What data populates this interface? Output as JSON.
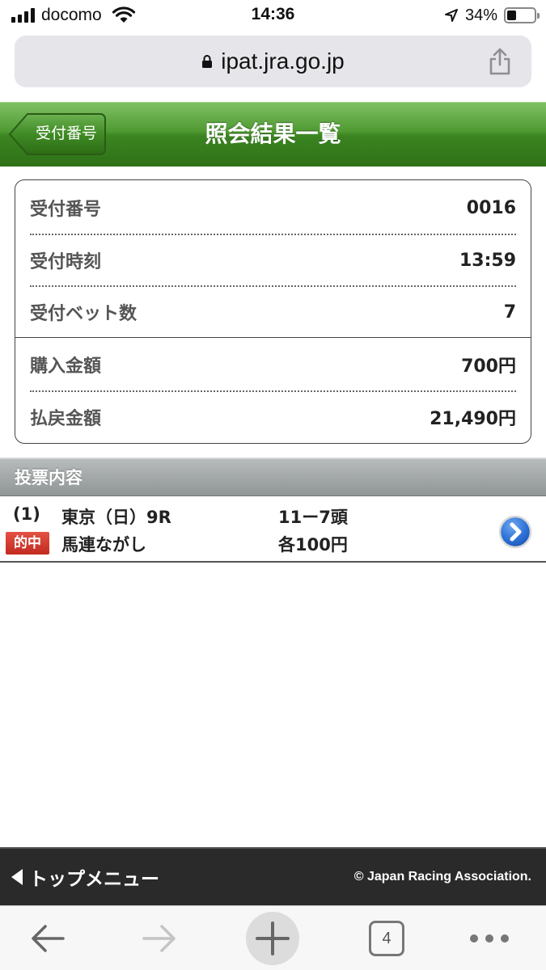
{
  "status_bar": {
    "carrier": "docomo",
    "time": "14:36",
    "battery_percent": "34%",
    "battery_level": 0.34
  },
  "browser": {
    "url": "ipat.jra.go.jp",
    "open_tabs": "4"
  },
  "header": {
    "back_label": "受付番号",
    "title": "照会結果一覧"
  },
  "summary": {
    "receipt_number": {
      "label": "受付番号",
      "value": "0016"
    },
    "receipt_time": {
      "label": "受付時刻",
      "value": "13:59"
    },
    "bet_count": {
      "label": "受付ベット数",
      "value": "7"
    },
    "purchase_amount": {
      "label": "購入金額",
      "value": "700円"
    },
    "payout_amount": {
      "label": "払戻金額",
      "value": "21,490円"
    }
  },
  "section": {
    "title": "投票内容"
  },
  "bets": [
    {
      "number": "(1)",
      "race": "東京（日）9R",
      "horses": "11ー7頭",
      "badge": "的中",
      "bet_type": "馬連ながし",
      "amount": "各100円"
    }
  ],
  "footer": {
    "menu_label": "トップメニュー",
    "copyright": "© Japan Racing Association."
  },
  "colors": {
    "header_green": "#3b8421",
    "hit_red": "#d23a2e",
    "detail_blue": "#2b6fd6",
    "footer_dark": "#2a2a2a"
  },
  "icons": [
    "wifi-icon",
    "location-arrow-icon",
    "battery-icon",
    "lock-icon",
    "share-icon",
    "chevron-right-icon",
    "triangle-left-icon",
    "back-arrow-icon",
    "forward-arrow-icon",
    "plus-icon",
    "more-icon"
  ]
}
